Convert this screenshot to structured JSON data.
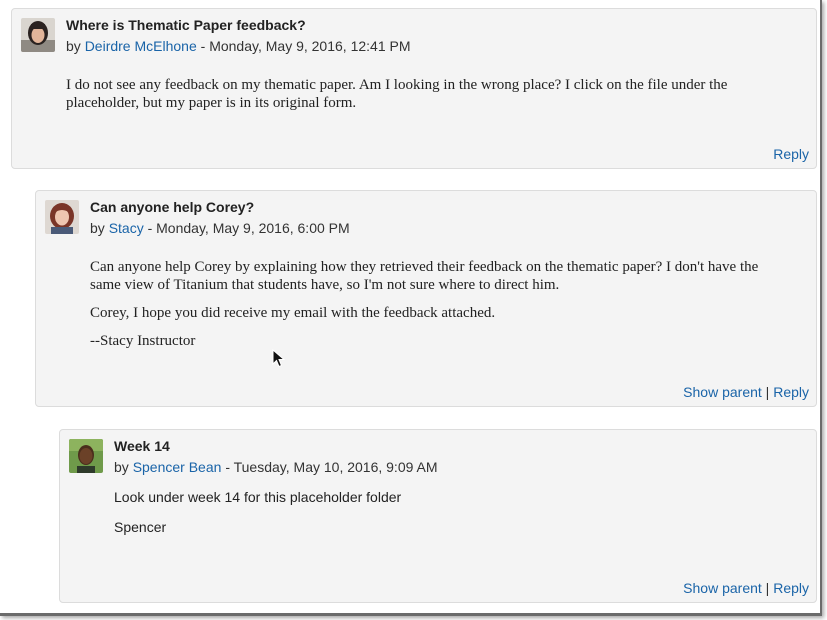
{
  "posts": [
    {
      "subject": "Where is Thematic Paper feedback?",
      "by": "by",
      "author": "Deirdre McElhone",
      "date": "- Monday, May 9, 2016, 12:41 PM",
      "paragraphs": [
        "I do not see any feedback on my thematic paper.  Am I looking in the wrong place?  I click on the file under the placeholder, but my paper is in its original form."
      ],
      "reply": "Reply"
    },
    {
      "subject": "Can anyone help Corey?",
      "by": "by",
      "author": "Stacy",
      "date": "- Monday, May 9, 2016, 6:00 PM",
      "paragraphs": [
        "Can anyone help Corey by explaining how they retrieved their feedback on the thematic paper? I don't have the same view of Titanium that students have, so I'm not sure where to direct him.",
        "Corey, I hope you did receive my email with the feedback attached.",
        "--Stacy Instructor"
      ],
      "show_parent": "Show parent",
      "separator": "|",
      "reply": "Reply"
    },
    {
      "subject": "Week 14",
      "by": "by",
      "author": "Spencer Bean",
      "date": "- Tuesday, May 10, 2016, 9:09 AM",
      "paragraphs": [
        "Look under week 14 for this placeholder folder",
        "Spencer"
      ],
      "show_parent": "Show parent",
      "separator": "|",
      "reply": "Reply"
    }
  ],
  "colors": {
    "link": "#1a64a8",
    "post_background": "#f4f4f4",
    "post_border": "#dcdcdc"
  }
}
